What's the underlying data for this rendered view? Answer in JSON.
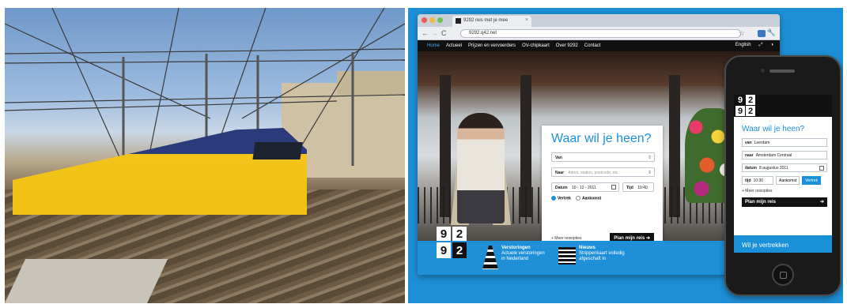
{
  "browser": {
    "tab_title": "9292 reis met je mee",
    "url": "9292.q42.net"
  },
  "site_nav": {
    "items": [
      "Home",
      "Actueel",
      "Prijzen en vervoerders",
      "OV-chipkaart",
      "Over 9292",
      "Contact"
    ],
    "language": "English"
  },
  "logo": {
    "top": [
      "9",
      "2"
    ],
    "bottom": [
      "9",
      "2"
    ]
  },
  "planner": {
    "heading": "Waar wil je heen?",
    "from_label": "Van",
    "to_label": "Naar",
    "to_placeholder": "Adres, station, postcode, etc",
    "date_label": "Datum",
    "date_value": "10 - 12 - 2011",
    "time_label": "Tijd",
    "time_value": "19:40",
    "depart_label": "Vertrek",
    "arrive_label": "Aankomst",
    "more_options": "+ Meer reisopties",
    "plan_button": "Plan mijn reis"
  },
  "strip": {
    "item1_title": "Verstoringen",
    "item1_text": "Actuele verstoringen in Nederland",
    "item2_title": "Nieuws",
    "item2_text": "Strippenkaart volledig afgeschaft in"
  },
  "mobile": {
    "heading": "Waar wil je heen?",
    "from_label": "van",
    "from_value": "Leerdam",
    "to_label": "naar",
    "to_value": "Amsterdam Centraal",
    "date_label": "datum",
    "date_value": "8 augustus 2011",
    "time_label": "tijd",
    "time_value": "10:30",
    "arrive_button": "Aankomst",
    "depart_button": "Vertrek",
    "more_options": "+ Meer reisopties",
    "plan_button": "Plan mijn reis",
    "footer_text": "Wil je vertrekken"
  },
  "colors": {
    "brand_blue": "#1a90d9",
    "panel_blue": "#1e8fd6",
    "black": "#111111"
  }
}
